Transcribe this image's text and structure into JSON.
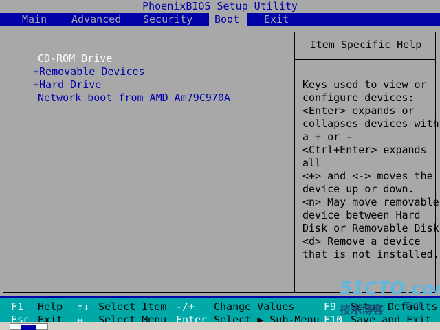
{
  "title": "PhoenixBIOS Setup Utility",
  "menu": {
    "tabs": [
      {
        "label": "Main",
        "active": false
      },
      {
        "label": "Advanced",
        "active": false
      },
      {
        "label": "Security",
        "active": false
      },
      {
        "label": "Boot",
        "active": true
      },
      {
        "label": "Exit",
        "active": false
      }
    ]
  },
  "boot": {
    "items": [
      {
        "label": "CD-ROM Drive",
        "selected": true
      },
      {
        "label": "+Removable Devices",
        "selected": false
      },
      {
        "label": "+Hard Drive",
        "selected": false
      },
      {
        "label": "Network boot from AMD Am79C970A",
        "selected": false
      }
    ]
  },
  "help": {
    "title": "Item Specific Help",
    "lines": [
      "Keys used to view or",
      "configure devices:",
      "<Enter> expands or",
      "collapses devices with",
      "a + or -",
      "<Ctrl+Enter> expands",
      "all",
      "<+> and <-> moves the",
      "device up or down.",
      "<n> May move removable",
      "device between Hard",
      "Disk or Removable Disk",
      "<d> Remove a device",
      "that is not installed."
    ]
  },
  "footer": {
    "row1": [
      {
        "text": "F1",
        "key": true
      },
      {
        "text": "Help",
        "key": false
      },
      {
        "text": "↑↓",
        "key": true
      },
      {
        "text": "Select Item",
        "key": false
      },
      {
        "text": "-/+",
        "key": true
      },
      {
        "text": "Change Values",
        "key": false
      },
      {
        "text": "F9",
        "key": true
      },
      {
        "text": "Setup Defaults",
        "key": false
      }
    ],
    "row2": [
      {
        "text": "Esc",
        "key": true
      },
      {
        "text": "Exit",
        "key": false
      },
      {
        "text": "↔",
        "key": true
      },
      {
        "text": "Select Menu",
        "key": false
      },
      {
        "text": "Enter",
        "key": true
      },
      {
        "text": "Select ▶ Sub-Menu",
        "key": false
      },
      {
        "text": "F10",
        "key": true
      },
      {
        "text": "Save and Exit",
        "key": false
      }
    ]
  },
  "watermark": {
    "line1": "51CTO.com",
    "line2": "技术博客",
    "line3": "Blog"
  },
  "colors": {
    "bios_blue": "#0000a8",
    "bios_gray": "#a8a8a8",
    "bios_cyan": "#00a8a8",
    "selected_text": "#ffffff"
  }
}
